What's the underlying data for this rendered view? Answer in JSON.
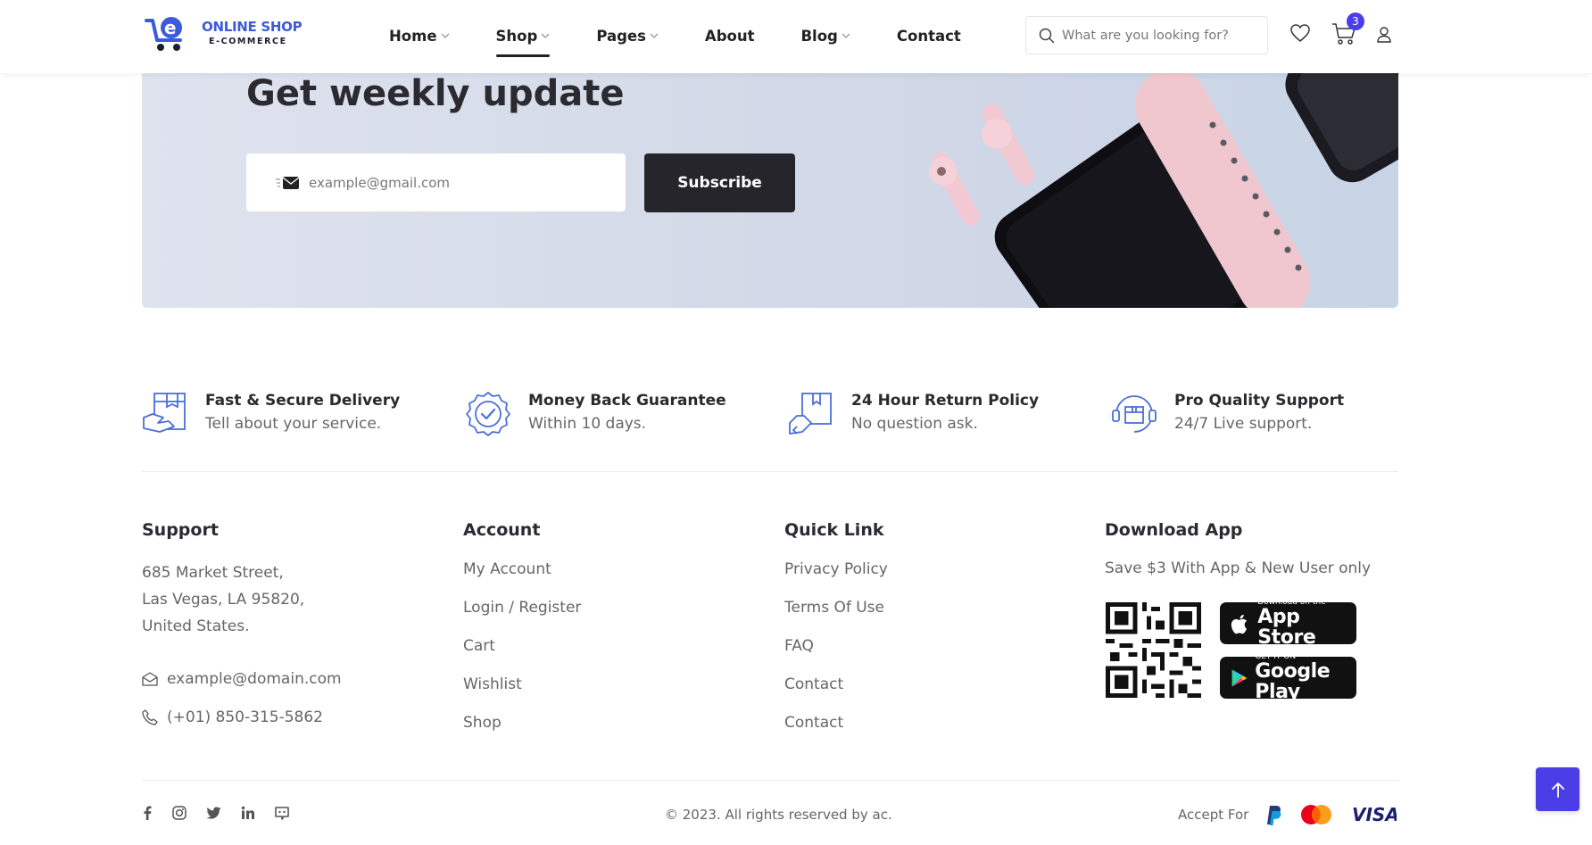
{
  "brand": {
    "name_line1": "ONLINE SHOP",
    "name_line2": "E-COMMERCE",
    "accent": "#3b5bdb"
  },
  "nav": {
    "home": "Home",
    "shop": "Shop",
    "pages": "Pages",
    "about": "About",
    "blog": "Blog",
    "contact": "Contact",
    "active": "Shop"
  },
  "search": {
    "placeholder": "What are you looking for?"
  },
  "cart": {
    "count": "3"
  },
  "icons": [
    "search-icon",
    "heart-icon",
    "cart-icon",
    "user-icon",
    "mail-icon",
    "phone-icon",
    "arrow-up-icon"
  ],
  "newsletter": {
    "title": "Get weekly update",
    "email_placeholder": "example@gmail.com",
    "subscribe_label": "Subscribe"
  },
  "features": [
    {
      "title": "Fast & Secure Delivery",
      "subtitle": "Tell about your service.",
      "icon": "delivery-box-icon"
    },
    {
      "title": "Money Back Guarantee",
      "subtitle": "Within 10 days.",
      "icon": "badge-check-icon"
    },
    {
      "title": "24 Hour Return Policy",
      "subtitle": "No question ask.",
      "icon": "return-box-icon"
    },
    {
      "title": "Pro Quality Support",
      "subtitle": "24/7 Live support.",
      "icon": "support-icon"
    }
  ],
  "footer": {
    "support": {
      "title": "Support",
      "address_line1": "685 Market Street,",
      "address_line2": "Las Vegas, LA 95820,",
      "address_line3": "United States.",
      "email": "example@domain.com",
      "phone": "(+01) 850-315-5862"
    },
    "account": {
      "title": "Account",
      "links": [
        "My Account",
        "Login / Register",
        "Cart",
        "Wishlist",
        "Shop"
      ]
    },
    "quick_link": {
      "title": "Quick Link",
      "links": [
        "Privacy Policy",
        "Terms Of Use",
        "FAQ",
        "Contact",
        "Contact"
      ]
    },
    "download": {
      "title": "Download App",
      "subtitle": "Save $3 With App & New User only",
      "appstore_small": "Download on the",
      "appstore_big": "App Store",
      "googleplay_small": "GET IT ON",
      "googleplay_big": "Google Play"
    }
  },
  "bottom": {
    "copyright": "© 2023. All rights reserved by ac.",
    "accept_label": "Accept For",
    "social": [
      "facebook-icon",
      "instagram-icon",
      "twitter-icon",
      "linkedin-icon",
      "discord-icon"
    ],
    "payments": [
      "paypal-icon",
      "mastercard-icon",
      "visa-icon"
    ],
    "visa_text": "VISA"
  },
  "colors": {
    "primary": "#4b3ee6",
    "dark": "#25252b",
    "muted": "#666666"
  }
}
